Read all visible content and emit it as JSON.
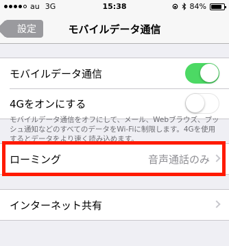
{
  "status_bar": {
    "carrier": "au",
    "network": "3G",
    "time": "15:38",
    "battery": "84%",
    "battery_level": 0.84,
    "signal_dots_filled": 4
  },
  "nav": {
    "back_label": "設定",
    "title": "モバイルデータ通信"
  },
  "cellular_group": {
    "mobile_data_label": "モバイルデータ通信",
    "mobile_data_on": true,
    "lte_label": "4Gをオンにする",
    "lte_on": false,
    "footnote": "モバイルデータ通信をオフにして、メール、Webブラウズ、プッシュ通知などのすべてのデータをWi-Fiに制限します。4Gを使用するとデータをより速く読み込めます。"
  },
  "roaming": {
    "label": "ローミング",
    "value": "音声通話のみ"
  },
  "tethering": {
    "label": "インターネット共有"
  },
  "colors": {
    "toggle_on": "#4cd964",
    "highlight": "#ff1a00",
    "background": "#efeff4"
  }
}
